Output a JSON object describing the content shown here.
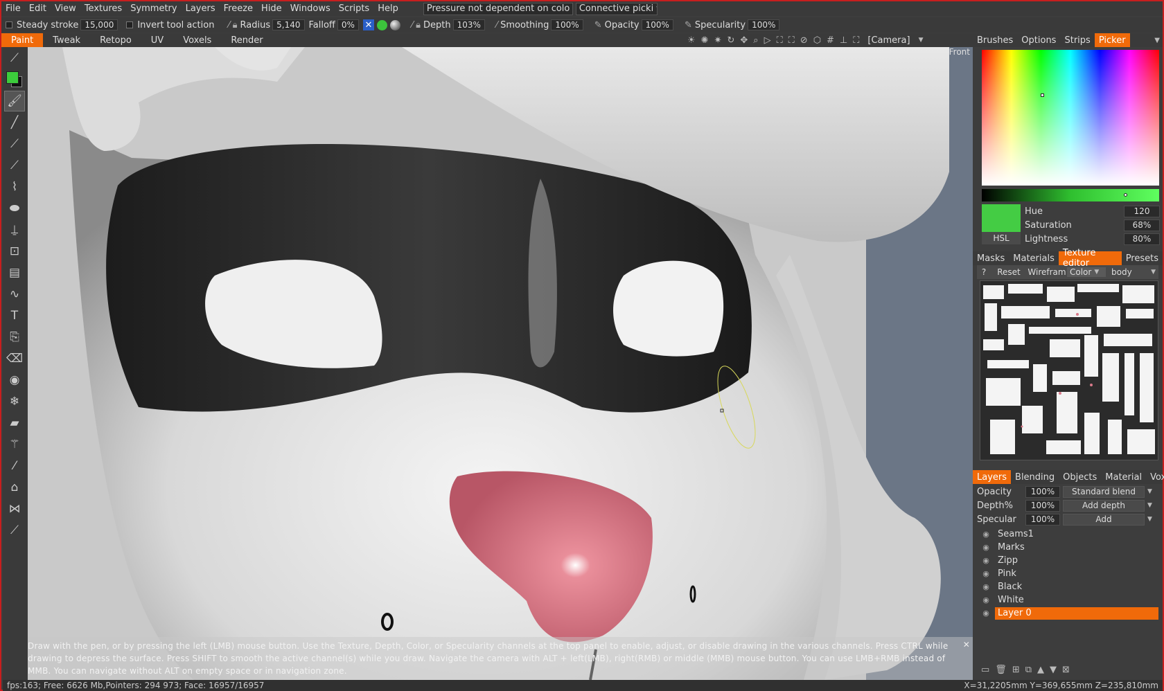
{
  "menu": {
    "items": [
      "File",
      "Edit",
      "View",
      "Textures",
      "Symmetry",
      "Layers",
      "Freeze",
      "Hide",
      "Windows",
      "Scripts",
      "Help"
    ],
    "pressure_combo": "Pressure not dependent on colo",
    "connective_combo": "Connective picki"
  },
  "toolbar": {
    "steady_label": "Steady stroke",
    "steady_value": "15,000",
    "invert_label": "Invert tool action",
    "radius_label": "Radius",
    "radius_value": "5,140",
    "falloff_label": "Falloff",
    "falloff_value": "0%",
    "depth_label": "Depth",
    "depth_value": "103%",
    "smoothing_label": "Smoothing",
    "smoothing_value": "100%",
    "opacity_label": "Opacity",
    "opacity_value": "100%",
    "specularity_label": "Specularity",
    "specularity_value": "100%"
  },
  "rooms": [
    "Paint",
    "Tweak",
    "Retopo",
    "UV",
    "Voxels",
    "Render"
  ],
  "camera_label": "[Camera]",
  "viewport": {
    "view_label": "Front",
    "hint": "Draw with the pen, or by pressing the left (LMB) mouse button. Use the Texture, Depth, Color, or Specularity channels at the top panel to enable, adjust, or disable drawing in the various channels. Press CTRL while drawing to depress the surface. Press SHIFT to smooth the active channel(s) while you draw. Navigate the camera with ALT + left(LMB), right(RMB)  or middle (MMB) mouse button. You can use LMB+RMB instead of MMB. You can navigate without ALT on empty space or in navigation zone."
  },
  "picker_tabs": [
    "Brushes",
    "Options",
    "Strips",
    "Picker"
  ],
  "color": {
    "swatch": "#44cc44",
    "mode": "HSL",
    "hue_label": "Hue",
    "hue": "120",
    "sat_label": "Saturation",
    "sat": "68%",
    "light_label": "Lightness",
    "light": "80%"
  },
  "texture_tabs": [
    "Masks",
    "Materials",
    "Texture editor",
    "Presets"
  ],
  "texture_toolbar": {
    "help": "?",
    "reset": "Reset",
    "wireframe": "Wirefram",
    "channel": "Color",
    "object": "body"
  },
  "layer_tabs": [
    "Layers",
    "Blending",
    "Objects",
    "Material",
    "VoxTree"
  ],
  "layer_props": {
    "opacity_label": "Opacity",
    "opacity": "100%",
    "blend": "Standard blend",
    "depth_label": "Depth%",
    "depth": "100%",
    "depth_mode": "Add depth",
    "spec_label": "Specular",
    "spec": "100%",
    "spec_mode": "Add"
  },
  "layers": [
    "Seams1",
    "Marks",
    "Zipp",
    "Pink",
    "Black",
    "White",
    "Layer 0"
  ],
  "status": {
    "left": "fps:163;    Free: 6626 Mb,Pointers: 294 973; Face: 16957/16957",
    "right": "X=31,2205mm  Y=369,655mm  Z=235,810mm"
  }
}
